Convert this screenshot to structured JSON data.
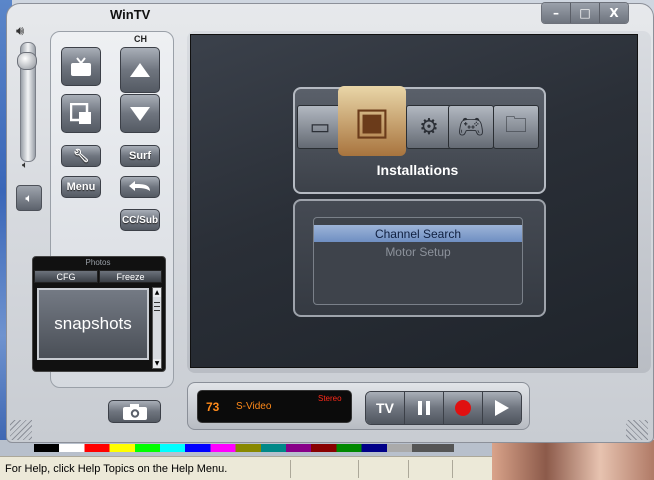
{
  "window": {
    "title": "WinTV",
    "controls": {
      "minimize": "–",
      "maximize": "□",
      "close": "X"
    }
  },
  "volume": {
    "top_icon": "speaker-high-icon",
    "bottom_icon": "speaker-low-icon",
    "mute_icon": "mute-speaker-icon",
    "level": 0.9
  },
  "channel_panel": {
    "ch_label": "CH",
    "tv_icon": "tv-icon",
    "pip_icon": "picture-in-picture-icon",
    "ch_up_icon": "triangle-up-icon",
    "ch_down_icon": "triangle-down-icon",
    "settings_icon": "wrench-icon",
    "surf_label": "Surf",
    "menu_label": "Menu",
    "back_icon": "back-arrow-icon",
    "cc_label": "CC/Sub"
  },
  "snapshots": {
    "photos_label": "Photos",
    "cfg_label": "CFG",
    "freeze_label": "Freeze",
    "view_text": "snapshots",
    "camera_icon": "camera-icon"
  },
  "osd": {
    "menu_icons": [
      "tv-set-icon",
      "installations-icon",
      "gears-icon",
      "gamepad-icon",
      "folder-icon"
    ],
    "selected_title": "Installations",
    "items": [
      {
        "label": "Channel Search",
        "selected": true
      },
      {
        "label": "Motor Setup",
        "selected": false
      }
    ]
  },
  "lcd": {
    "channel": "73",
    "source": "S-Video",
    "audio": "Stereo"
  },
  "transport": {
    "tv_label": "TV",
    "pause_icon": "pause-icon",
    "record_icon": "record-icon",
    "play_icon": "play-icon"
  },
  "statusbar": {
    "text": "For Help, click Help Topics on the Help Menu."
  },
  "colors": {
    "lcd_text": "#ff8a1a",
    "lcd_audio": "#ff2a1a",
    "highlight": "#8aa6d2",
    "record": "#e01010"
  }
}
